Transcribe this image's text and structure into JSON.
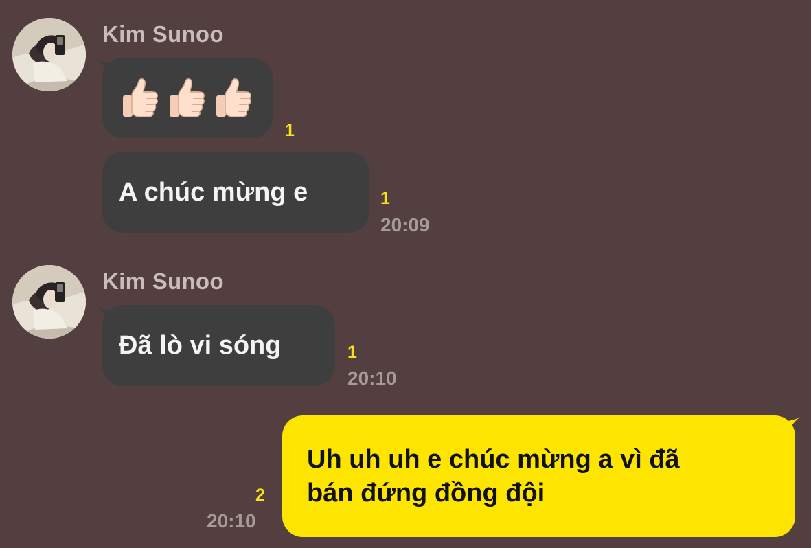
{
  "theme": {
    "background": "#533f40",
    "incoming_bubble": "#3e3e3f",
    "outgoing_bubble": "#fde500",
    "unread_color": "#f6e21b"
  },
  "messages": {
    "group1": {
      "sender": "Kim Sunoo",
      "first": {
        "emoji": [
          "thumbs-up-icon",
          "thumbs-up-icon",
          "thumbs-up-icon"
        ],
        "unread": "1"
      },
      "second": {
        "text": "A chúc mừng e",
        "unread": "1",
        "time": "20:09"
      }
    },
    "group2": {
      "sender": "Kim Sunoo",
      "first": {
        "text": "Đã lò vi sóng",
        "unread": "1",
        "time": "20:10"
      }
    },
    "outgoing": {
      "line1": "Uh uh uh e chúc mừng a vì đã",
      "line2": "bán đứng đồng đội",
      "unread": "2",
      "time": "20:10"
    }
  }
}
